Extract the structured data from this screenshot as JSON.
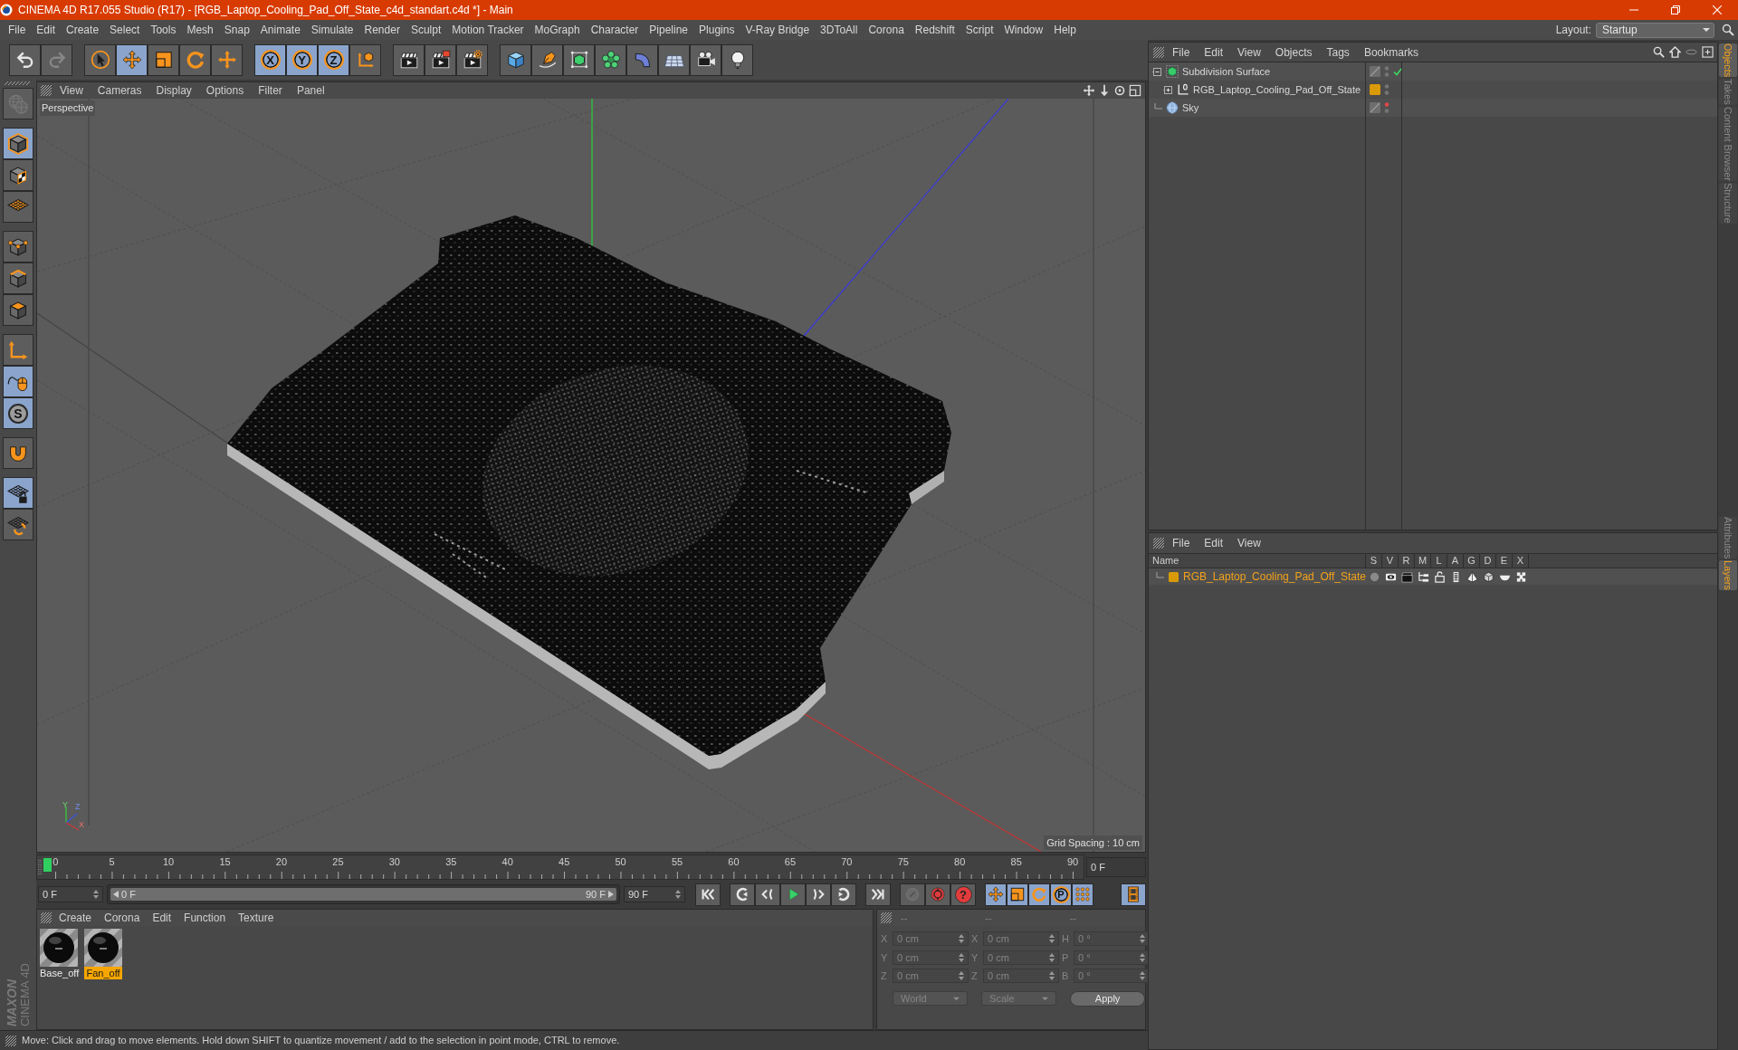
{
  "window": {
    "title": "CINEMA 4D R17.055 Studio (R17) - [RGB_Laptop_Cooling_Pad_Off_State_c4d_standart.c4d *] - Main"
  },
  "menu_bar": {
    "items": [
      "File",
      "Edit",
      "Create",
      "Select",
      "Tools",
      "Mesh",
      "Snap",
      "Animate",
      "Simulate",
      "Render",
      "Sculpt",
      "Motion Tracker",
      "MoGraph",
      "Character",
      "Pipeline",
      "Plugins",
      "V-Ray Bridge",
      "3DToAll",
      "Corona",
      "Redshift",
      "Script",
      "Window",
      "Help"
    ],
    "layout_label": "Layout:",
    "layout_value": "Startup"
  },
  "toolbar": {
    "tools": [
      {
        "selected": false,
        "disabled": false
      },
      {
        "selected": false,
        "disabled": true
      },
      {
        "selected": false,
        "disabled": false
      },
      {
        "selected": true,
        "disabled": false
      },
      {
        "selected": false,
        "disabled": false
      },
      {
        "selected": false,
        "disabled": false
      },
      {
        "selected": false,
        "disabled": false
      },
      {
        "label": "X",
        "selected": true,
        "disabled": false
      },
      {
        "label": "Y",
        "selected": true,
        "disabled": false
      },
      {
        "label": "Z",
        "selected": true,
        "disabled": false
      },
      {
        "selected": false,
        "disabled": false
      },
      {
        "selected": false,
        "disabled": false
      },
      {
        "selected": false,
        "disabled": false
      },
      {
        "selected": false,
        "disabled": false
      },
      {
        "selected": false,
        "disabled": false
      },
      {
        "selected": false,
        "disabled": false
      },
      {
        "selected": false,
        "disabled": false
      },
      {
        "selected": false,
        "disabled": false
      },
      {
        "selected": false,
        "disabled": false
      },
      {
        "selected": false,
        "disabled": false
      },
      {
        "selected": false,
        "disabled": false
      },
      {
        "selected": false,
        "disabled": false
      }
    ]
  },
  "left_toolbar": {
    "tools": [
      {
        "selected": false,
        "disabled": true
      },
      {
        "selected": true,
        "disabled": false
      },
      {
        "selected": false,
        "disabled": false
      },
      {
        "selected": false,
        "disabled": false
      },
      {
        "selected": false,
        "disabled": false
      },
      {
        "selected": false,
        "disabled": false
      },
      {
        "selected": false,
        "disabled": false
      },
      {
        "selected": false,
        "disabled": false
      },
      {
        "selected": true,
        "disabled": false
      },
      {
        "label": "S",
        "selected": true,
        "disabled": false
      },
      {
        "selected": false,
        "disabled": false
      },
      {
        "selected": true,
        "disabled": false
      },
      {
        "selected": false,
        "disabled": false
      }
    ]
  },
  "viewport": {
    "menu": [
      "View",
      "Cameras",
      "Display",
      "Options",
      "Filter",
      "Panel"
    ],
    "camera": "Perspective",
    "grid_spacing": "Grid Spacing : 10 cm",
    "gizmo_labels": [
      "Y",
      "Z",
      "X"
    ]
  },
  "timeline": {
    "ticks": [
      "0",
      "5",
      "10",
      "15",
      "20",
      "25",
      "30",
      "35",
      "40",
      "45",
      "50",
      "55",
      "60",
      "65",
      "70",
      "75",
      "80",
      "85",
      "90"
    ],
    "level": 0,
    "current_frame": "0 F",
    "start": "0 F",
    "range_slider": {
      "start": "0 F",
      "end": "90 F",
      "level": 1
    },
    "end": "90 F",
    "controls": [
      {
        "selected": false,
        "disabled": false
      },
      {
        "selected": false,
        "disabled": false
      },
      {
        "selected": false,
        "disabled": false
      },
      {
        "selected": false,
        "disabled": false
      },
      {
        "selected": false,
        "disabled": false
      },
      {
        "selected": false,
        "disabled": false
      },
      {
        "selected": false,
        "disabled": false
      },
      {
        "selected": false,
        "disabled": true
      },
      {
        "selected": false,
        "disabled": false
      },
      {
        "label": "?",
        "selected": false,
        "disabled": false
      },
      {
        "selected": true,
        "disabled": false
      },
      {
        "selected": true,
        "disabled": false
      },
      {
        "selected": true,
        "disabled": false
      },
      {
        "label": "P",
        "selected": true,
        "disabled": false
      },
      {
        "selected": true,
        "disabled": false
      },
      {
        "selected": true,
        "disabled": false
      }
    ]
  },
  "materials": {
    "menu": [
      "Create",
      "Corona",
      "Edit",
      "Function",
      "Texture"
    ],
    "items": [
      {
        "name": "Base_off",
        "selected": false
      },
      {
        "name": "Fan_off",
        "selected": true
      }
    ]
  },
  "coordinates": {
    "disabled": true,
    "headers": [
      "--",
      "--",
      "--"
    ],
    "rows": [
      {
        "position_axis": "X",
        "position": "0 cm",
        "size_axis": "X",
        "size": "0 cm",
        "rotation_axis": "H",
        "rotation": "0 °"
      },
      {
        "position_axis": "Y",
        "position": "0 cm",
        "size_axis": "Y",
        "size": "0 cm",
        "rotation_axis": "P",
        "rotation": "0 °"
      },
      {
        "position_axis": "Z",
        "position": "0 cm",
        "size_axis": "Z",
        "size": "0 cm",
        "rotation_axis": "B",
        "rotation": "0 °"
      }
    ],
    "coordinate_system": "World",
    "size_mode": "Scale",
    "apply": "Apply"
  },
  "status_bar": {
    "text": "Move: Click and drag to move elements. Hold down SHIFT to quantize movement / add to the selection in point mode, CTRL to remove."
  },
  "logo": {
    "brand": "MAXON",
    "product": "CINEMA 4D"
  },
  "object_manager": {
    "menu": [
      "File",
      "Edit",
      "View",
      "Objects",
      "Tags",
      "Bookmarks"
    ],
    "objects": [
      {
        "name": "Subdivision Surface",
        "kind": "subdivision",
        "has_children": true,
        "expanded": true,
        "enabled": true,
        "editor_hidden": false,
        "render_hidden": false,
        "children": [
          {
            "name": "RGB_Laptop_Cooling_Pad_Off_State",
            "kind": "null",
            "has_children": true,
            "expanded": false,
            "enabled": false,
            "editor_hidden": false,
            "render_hidden": false,
            "color": "#d99a08"
          }
        ]
      },
      {
        "name": "Sky",
        "kind": "sky",
        "has_children": false,
        "expanded": false,
        "enabled": false,
        "editor_hidden": true,
        "render_hidden": false
      }
    ]
  },
  "layer_manager": {
    "menu": [
      "File",
      "Edit",
      "View"
    ],
    "columns": [
      "Name",
      "S",
      "V",
      "R",
      "M",
      "L",
      "A",
      "G",
      "D",
      "E",
      "X"
    ],
    "layers": [
      {
        "name": "RGB_Laptop_Cooling_Pad_Off_State",
        "color": "#d99a08"
      }
    ]
  },
  "side_tabs": {
    "top": [
      {
        "label": "Objects",
        "selected": true
      },
      {
        "label": "Takes",
        "selected": false
      },
      {
        "label": "Content Browser",
        "selected": false
      },
      {
        "label": "Structure",
        "selected": false
      }
    ],
    "bottom": [
      {
        "label": "Attributes",
        "selected": false
      },
      {
        "label": "Layers",
        "selected": true
      }
    ]
  }
}
